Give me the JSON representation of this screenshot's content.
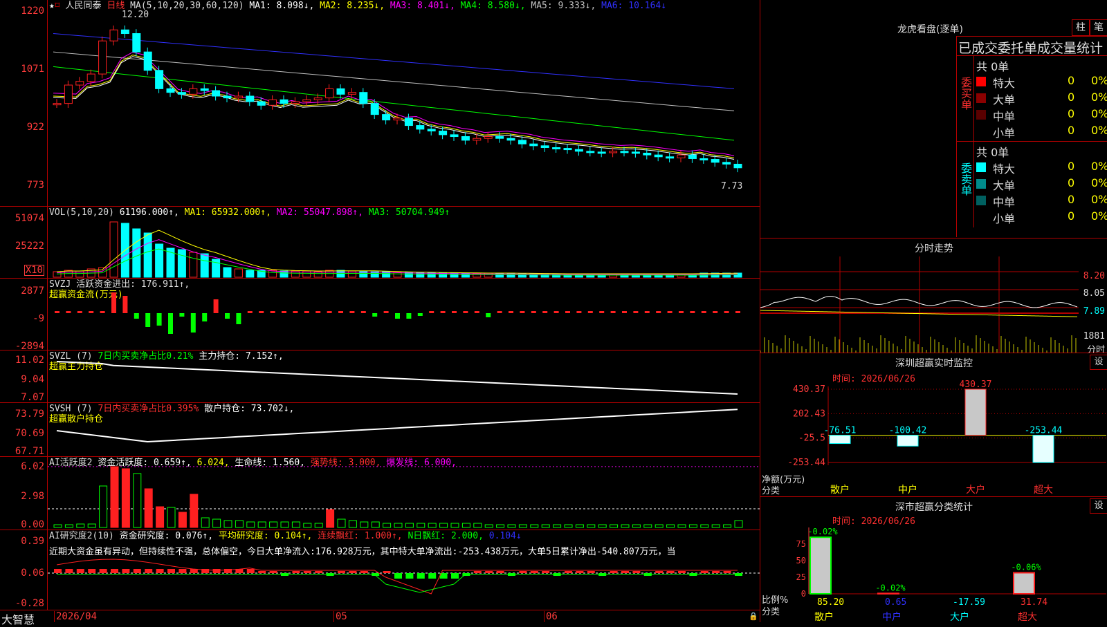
{
  "colors": {
    "up": "#ff2020",
    "down": "#00ffff",
    "grid": "#b40000",
    "ma1": "#ffffff",
    "ma2": "#ffff00",
    "ma3": "#ff00ff",
    "ma4": "#00ff00",
    "ma5": "#c0c0c0",
    "ma6": "#3030ff"
  },
  "header": {
    "stock": "人民同泰",
    "period": "日线",
    "ma_label": "MA(5,10,20,30,60,120)",
    "ma1": "MA1: 8.098↓,",
    "ma2": "MA2: 8.235↓,",
    "ma3": "MA3: 8.401↓,",
    "ma4": "MA4: 8.580↓,",
    "ma5": "MA5: 9.333↓,",
    "ma6": "MA6: 10.164↓",
    "high": "12.20",
    "low": "7.73"
  },
  "price_axis": [
    "1220",
    "1071",
    "922",
    "773"
  ],
  "vol": {
    "label": "VOL(5,10,20)",
    "value": "61196.000↑,",
    "ma1": "MA1: 65932.000↑,",
    "ma2": "MA2: 55047.898↑,",
    "ma3": "MA3: 50704.949↑",
    "axis": [
      "51074",
      "25222"
    ],
    "unit": "X10"
  },
  "svzj": {
    "label": "SVZJ  活跃资金进出: 176.911↑,",
    "note": "超赢资金流(万元)",
    "axis": [
      "2877",
      "-9",
      "-2894"
    ]
  },
  "svzl": {
    "label": "SVZL (7)",
    "pct": "7日内买卖净占比0.21%",
    "hold": "主力持仓: 7.152↑,",
    "note": "超赢主力持仓",
    "axis": [
      "11.02",
      "9.04",
      "7.07"
    ]
  },
  "svsh": {
    "label": "SVSH (7)",
    "pct": "7日内买卖净占比0.395%",
    "hold": "散户持仓: 73.702↓,",
    "note": "超赢散户持仓",
    "axis": [
      "73.79",
      "70.69",
      "67.71"
    ]
  },
  "ai1": {
    "label": "AI活跃度2",
    "a": "资金活跃度: 0.659↑,",
    "b": "6.024,",
    "c": "生命线: 1.560,",
    "d": "强势线: 3.000,",
    "e": "爆发线: 6.000,",
    "axis": [
      "6.02",
      "2.98",
      "0.00"
    ]
  },
  "ai2": {
    "label": "AI研究度2(10)",
    "a": "资金研究度: 0.076↑,",
    "b": "平均研究度: 0.104↑,",
    "c": "连续飘红: 1.000↑,",
    "d": "N日飘红: 2.000,",
    "e": "0.104↓",
    "text": "近期大资金虽有异动，但持续性不强，总体偏空，今日大单净流入:176.928万元，其中特大单净流出:-253.438万元，大单5日累计净出-540.807万元，当",
    "axis": [
      "0.39",
      "0.06",
      "-0.28"
    ]
  },
  "dates": [
    "2026/04",
    "05",
    "06"
  ],
  "brand": "大智慧",
  "right": {
    "lhb_title": "龙虎看盘(逐单)",
    "btn_bar": "柱",
    "btn_pen": "笔",
    "stats_title": "已成交委托单成交量统计",
    "buy": {
      "side": "委买单",
      "total": "共 0单",
      "rows": [
        {
          "label": "特大",
          "n": "0",
          "p": "0%",
          "color": "#ff0000"
        },
        {
          "label": "大单",
          "n": "0",
          "p": "0%",
          "color": "#8b0000"
        },
        {
          "label": "中单",
          "n": "0",
          "p": "0%",
          "color": "#5a0000"
        },
        {
          "label": "小单",
          "n": "0",
          "p": "0%",
          "color": "#000000"
        }
      ]
    },
    "sell": {
      "side": "委卖单",
      "total": "共 0单",
      "rows": [
        {
          "label": "特大",
          "n": "0",
          "p": "0%",
          "color": "#00ffff"
        },
        {
          "label": "大单",
          "n": "0",
          "p": "0%",
          "color": "#008b8b"
        },
        {
          "label": "中单",
          "n": "0",
          "p": "0%",
          "color": "#006060"
        },
        {
          "label": "小单",
          "n": "0",
          "p": "0%",
          "color": "#000000"
        }
      ]
    },
    "intraday": {
      "title": "分时走势",
      "axis": [
        "8.20",
        "8.05",
        "7.89"
      ],
      "vol_axis": "1881",
      "unit": "分时"
    },
    "monitor": {
      "title": "深圳超赢实时监控",
      "gear": "设",
      "time": "时间: 2026/06/26",
      "axis": [
        "430.37",
        "202.43",
        "-25.5",
        "-253.44"
      ],
      "ylabel": "净额(万元)",
      "xlabel": "分类",
      "chart_data": {
        "type": "bar",
        "categories": [
          "散户",
          "中户",
          "大户",
          "超大"
        ],
        "values": [
          -76.51,
          -100.42,
          430.37,
          -253.44
        ],
        "labels": [
          "-76.51",
          "-100.42",
          "430.37",
          "-253.44"
        ],
        "ylim": [
          -253.44,
          430.37
        ]
      }
    },
    "classify": {
      "title": "深市超赢分类统计",
      "gear": "设",
      "time": "时间: 2026/06/26",
      "axis": [
        "75",
        "50",
        "25",
        "0"
      ],
      "ylabel": "比例%",
      "xlabel": "分类",
      "chart_data": {
        "type": "bar",
        "categories": [
          "散户",
          "中户",
          "大户",
          "超大"
        ],
        "values": [
          85.2,
          0.65,
          -17.59,
          31.74
        ],
        "top_labels": [
          "-0.02%",
          "-0.02%",
          "",
          "-0.06%"
        ],
        "value_labels": [
          "85.20",
          "0.65",
          "-17.59",
          "31.74"
        ],
        "ylim": [
          0,
          100
        ]
      }
    }
  }
}
